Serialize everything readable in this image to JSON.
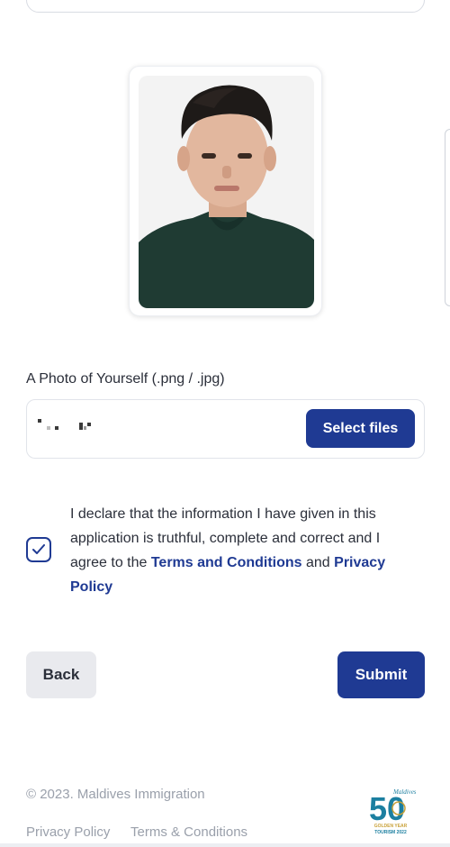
{
  "photo": {
    "alt": "Uploaded photo preview"
  },
  "upload": {
    "label": "A Photo of Yourself (.png / .jpg)",
    "select_label": "Select files"
  },
  "declaration": {
    "text_before": "I declare that the information I have given in this application is truthful, complete and correct and I agree to the ",
    "terms_link": "Terms and Conditions",
    "and": " and ",
    "privacy_link": "Privacy Policy",
    "checked": true
  },
  "actions": {
    "back_label": "Back",
    "submit_label": "Submit"
  },
  "footer": {
    "copyright": "© 2023. Maldives Immigration",
    "privacy_link": "Privacy Policy",
    "terms_link": "Terms & Conditions",
    "logo": {
      "number": "50",
      "script": "Maldives",
      "line1": "GOLDEN YEAR",
      "line2": "TOURISM 2022",
      "color_primary": "#1c7fa0",
      "color_accent": "#c9a23a"
    }
  },
  "colors": {
    "primary": "#1f3a93",
    "muted_text": "#9aa0ab",
    "border": "#e1e4ea"
  }
}
